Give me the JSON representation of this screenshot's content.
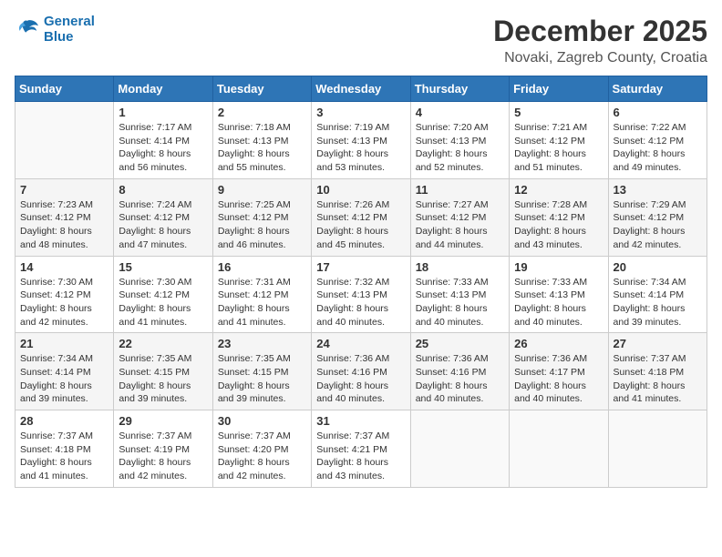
{
  "header": {
    "logo_line1": "General",
    "logo_line2": "Blue",
    "month_year": "December 2025",
    "location": "Novaki, Zagreb County, Croatia"
  },
  "weekdays": [
    "Sunday",
    "Monday",
    "Tuesday",
    "Wednesday",
    "Thursday",
    "Friday",
    "Saturday"
  ],
  "weeks": [
    [
      {
        "day": "",
        "sunrise": "",
        "sunset": "",
        "daylight": ""
      },
      {
        "day": "1",
        "sunrise": "Sunrise: 7:17 AM",
        "sunset": "Sunset: 4:14 PM",
        "daylight": "Daylight: 8 hours and 56 minutes."
      },
      {
        "day": "2",
        "sunrise": "Sunrise: 7:18 AM",
        "sunset": "Sunset: 4:13 PM",
        "daylight": "Daylight: 8 hours and 55 minutes."
      },
      {
        "day": "3",
        "sunrise": "Sunrise: 7:19 AM",
        "sunset": "Sunset: 4:13 PM",
        "daylight": "Daylight: 8 hours and 53 minutes."
      },
      {
        "day": "4",
        "sunrise": "Sunrise: 7:20 AM",
        "sunset": "Sunset: 4:13 PM",
        "daylight": "Daylight: 8 hours and 52 minutes."
      },
      {
        "day": "5",
        "sunrise": "Sunrise: 7:21 AM",
        "sunset": "Sunset: 4:12 PM",
        "daylight": "Daylight: 8 hours and 51 minutes."
      },
      {
        "day": "6",
        "sunrise": "Sunrise: 7:22 AM",
        "sunset": "Sunset: 4:12 PM",
        "daylight": "Daylight: 8 hours and 49 minutes."
      }
    ],
    [
      {
        "day": "7",
        "sunrise": "Sunrise: 7:23 AM",
        "sunset": "Sunset: 4:12 PM",
        "daylight": "Daylight: 8 hours and 48 minutes."
      },
      {
        "day": "8",
        "sunrise": "Sunrise: 7:24 AM",
        "sunset": "Sunset: 4:12 PM",
        "daylight": "Daylight: 8 hours and 47 minutes."
      },
      {
        "day": "9",
        "sunrise": "Sunrise: 7:25 AM",
        "sunset": "Sunset: 4:12 PM",
        "daylight": "Daylight: 8 hours and 46 minutes."
      },
      {
        "day": "10",
        "sunrise": "Sunrise: 7:26 AM",
        "sunset": "Sunset: 4:12 PM",
        "daylight": "Daylight: 8 hours and 45 minutes."
      },
      {
        "day": "11",
        "sunrise": "Sunrise: 7:27 AM",
        "sunset": "Sunset: 4:12 PM",
        "daylight": "Daylight: 8 hours and 44 minutes."
      },
      {
        "day": "12",
        "sunrise": "Sunrise: 7:28 AM",
        "sunset": "Sunset: 4:12 PM",
        "daylight": "Daylight: 8 hours and 43 minutes."
      },
      {
        "day": "13",
        "sunrise": "Sunrise: 7:29 AM",
        "sunset": "Sunset: 4:12 PM",
        "daylight": "Daylight: 8 hours and 42 minutes."
      }
    ],
    [
      {
        "day": "14",
        "sunrise": "Sunrise: 7:30 AM",
        "sunset": "Sunset: 4:12 PM",
        "daylight": "Daylight: 8 hours and 42 minutes."
      },
      {
        "day": "15",
        "sunrise": "Sunrise: 7:30 AM",
        "sunset": "Sunset: 4:12 PM",
        "daylight": "Daylight: 8 hours and 41 minutes."
      },
      {
        "day": "16",
        "sunrise": "Sunrise: 7:31 AM",
        "sunset": "Sunset: 4:12 PM",
        "daylight": "Daylight: 8 hours and 41 minutes."
      },
      {
        "day": "17",
        "sunrise": "Sunrise: 7:32 AM",
        "sunset": "Sunset: 4:13 PM",
        "daylight": "Daylight: 8 hours and 40 minutes."
      },
      {
        "day": "18",
        "sunrise": "Sunrise: 7:33 AM",
        "sunset": "Sunset: 4:13 PM",
        "daylight": "Daylight: 8 hours and 40 minutes."
      },
      {
        "day": "19",
        "sunrise": "Sunrise: 7:33 AM",
        "sunset": "Sunset: 4:13 PM",
        "daylight": "Daylight: 8 hours and 40 minutes."
      },
      {
        "day": "20",
        "sunrise": "Sunrise: 7:34 AM",
        "sunset": "Sunset: 4:14 PM",
        "daylight": "Daylight: 8 hours and 39 minutes."
      }
    ],
    [
      {
        "day": "21",
        "sunrise": "Sunrise: 7:34 AM",
        "sunset": "Sunset: 4:14 PM",
        "daylight": "Daylight: 8 hours and 39 minutes."
      },
      {
        "day": "22",
        "sunrise": "Sunrise: 7:35 AM",
        "sunset": "Sunset: 4:15 PM",
        "daylight": "Daylight: 8 hours and 39 minutes."
      },
      {
        "day": "23",
        "sunrise": "Sunrise: 7:35 AM",
        "sunset": "Sunset: 4:15 PM",
        "daylight": "Daylight: 8 hours and 39 minutes."
      },
      {
        "day": "24",
        "sunrise": "Sunrise: 7:36 AM",
        "sunset": "Sunset: 4:16 PM",
        "daylight": "Daylight: 8 hours and 40 minutes."
      },
      {
        "day": "25",
        "sunrise": "Sunrise: 7:36 AM",
        "sunset": "Sunset: 4:16 PM",
        "daylight": "Daylight: 8 hours and 40 minutes."
      },
      {
        "day": "26",
        "sunrise": "Sunrise: 7:36 AM",
        "sunset": "Sunset: 4:17 PM",
        "daylight": "Daylight: 8 hours and 40 minutes."
      },
      {
        "day": "27",
        "sunrise": "Sunrise: 7:37 AM",
        "sunset": "Sunset: 4:18 PM",
        "daylight": "Daylight: 8 hours and 41 minutes."
      }
    ],
    [
      {
        "day": "28",
        "sunrise": "Sunrise: 7:37 AM",
        "sunset": "Sunset: 4:18 PM",
        "daylight": "Daylight: 8 hours and 41 minutes."
      },
      {
        "day": "29",
        "sunrise": "Sunrise: 7:37 AM",
        "sunset": "Sunset: 4:19 PM",
        "daylight": "Daylight: 8 hours and 42 minutes."
      },
      {
        "day": "30",
        "sunrise": "Sunrise: 7:37 AM",
        "sunset": "Sunset: 4:20 PM",
        "daylight": "Daylight: 8 hours and 42 minutes."
      },
      {
        "day": "31",
        "sunrise": "Sunrise: 7:37 AM",
        "sunset": "Sunset: 4:21 PM",
        "daylight": "Daylight: 8 hours and 43 minutes."
      },
      {
        "day": "",
        "sunrise": "",
        "sunset": "",
        "daylight": ""
      },
      {
        "day": "",
        "sunrise": "",
        "sunset": "",
        "daylight": ""
      },
      {
        "day": "",
        "sunrise": "",
        "sunset": "",
        "daylight": ""
      }
    ]
  ]
}
